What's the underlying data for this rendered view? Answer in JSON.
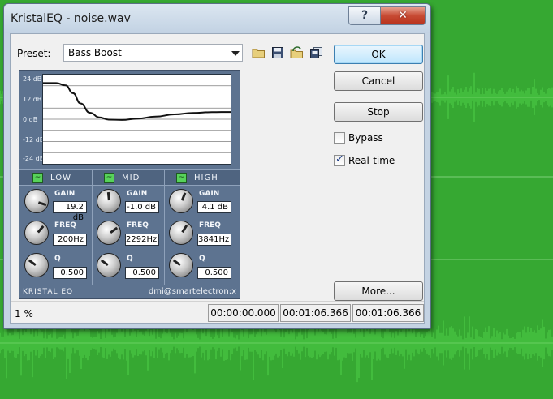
{
  "window": {
    "title": "KristalEQ - noise.wav",
    "help_glyph": "?",
    "close_glyph": "✕"
  },
  "preset": {
    "label": "Preset:",
    "value": "Bass Boost"
  },
  "toolbar_icons": [
    "folder-open-icon",
    "save-icon",
    "preset-manage-icon",
    "copy-icon"
  ],
  "buttons": {
    "ok": "OK",
    "cancel": "Cancel",
    "stop": "Stop",
    "more": "More..."
  },
  "checkboxes": [
    {
      "label": "Bypass",
      "checked": false
    },
    {
      "label": "Real-time",
      "checked": true
    }
  ],
  "graph": {
    "db_labels": [
      "24 dB",
      "12 dB",
      "0 dB",
      "-12 dB",
      "-24 dB"
    ],
    "db_range": [
      -24,
      24
    ],
    "curve_db": [
      [
        0.0,
        19.5
      ],
      [
        0.07,
        19.5
      ],
      [
        0.12,
        18.2
      ],
      [
        0.16,
        14.0
      ],
      [
        0.2,
        8.5
      ],
      [
        0.25,
        3.5
      ],
      [
        0.3,
        1.0
      ],
      [
        0.35,
        -0.2
      ],
      [
        0.42,
        -0.4
      ],
      [
        0.5,
        0.3
      ],
      [
        0.6,
        1.4
      ],
      [
        0.7,
        2.6
      ],
      [
        0.8,
        3.4
      ],
      [
        0.9,
        3.8
      ],
      [
        1.0,
        3.9
      ]
    ]
  },
  "bands": [
    {
      "name": "LOW",
      "led": "~",
      "gain_label": "GAIN",
      "gain": "19.2 dB",
      "freq_label": "FREQ",
      "freq": "200Hz",
      "q_label": "Q",
      "q": "0.500",
      "gain_norm": 0.9,
      "freq_norm": 0.65,
      "q_norm": 0.3
    },
    {
      "name": "MID",
      "led": "~",
      "gain_label": "GAIN",
      "gain": "-1.0 dB",
      "freq_label": "FREQ",
      "freq": "2292Hz",
      "q_label": "Q",
      "q": "0.500",
      "gain_norm": 0.48,
      "freq_norm": 0.7,
      "q_norm": 0.3
    },
    {
      "name": "HIGH",
      "led": "~",
      "gain_label": "GAIN",
      "gain": "4.1 dB",
      "freq_label": "FREQ",
      "freq": "3841Hz",
      "q_label": "Q",
      "q": "0.500",
      "gain_norm": 0.58,
      "freq_norm": 0.62,
      "q_norm": 0.3
    }
  ],
  "plugin_footer": {
    "left": "KRISTAL EQ",
    "right": "dmi@smartelectron:x"
  },
  "status": {
    "progress": "1 %",
    "time_start": "00:00:00.000",
    "time_current": "00:01:06.366",
    "time_end": "00:01:06.366"
  },
  "colors": {
    "background_green": "#36a832",
    "plugin_panel": "#5d7390",
    "led_green": "#57d35a"
  }
}
